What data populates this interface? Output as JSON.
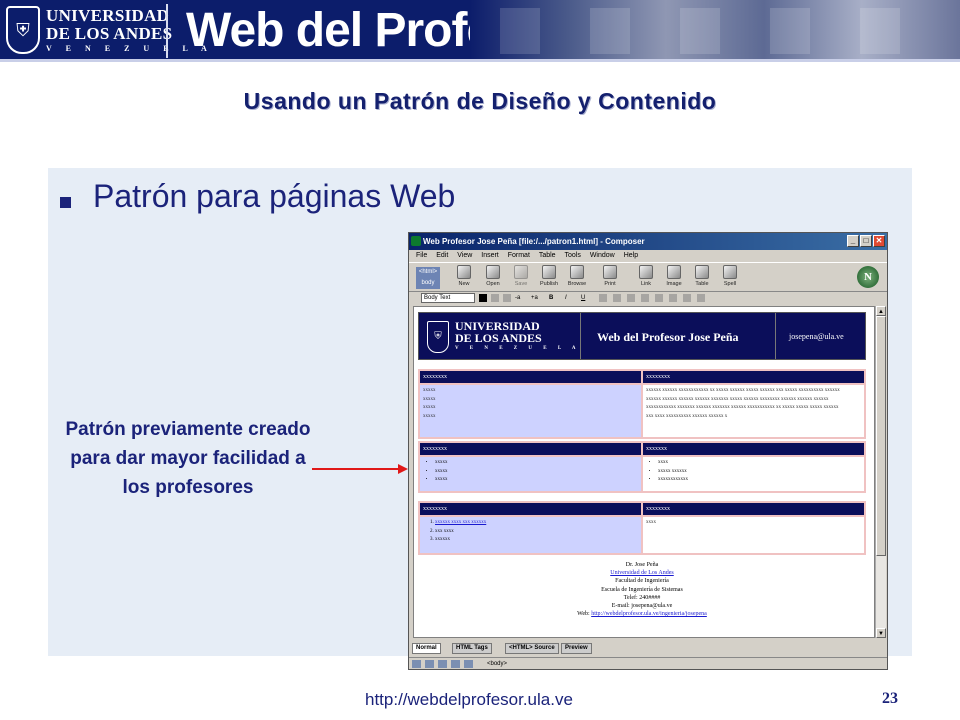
{
  "banner": {
    "university": "UNIVERSIDAD",
    "university2": "DE LOS ANDES",
    "venezuela": "V E N E Z U E L A",
    "site_title": "Web del Profesor"
  },
  "slide": {
    "title": "Usando un Patrón de Diseño y Contenido",
    "bullet": "Patrón para páginas Web",
    "callout": "Patrón previamente creado para dar mayor facilidad a los profesores",
    "footer_url": "http://webdelprofesor.ula.ve",
    "page_number": "23"
  },
  "composer": {
    "window_title": "Web Profesor Jose Peña [file:/.../patron1.html] - Composer",
    "menu": [
      "File",
      "Edit",
      "View",
      "Insert",
      "Format",
      "Table",
      "Tools",
      "Window",
      "Help"
    ],
    "toolbar": [
      "New",
      "Open",
      "Save",
      "Publish",
      "Browse",
      "Print",
      "Link",
      "Image",
      "Table",
      "Spell"
    ],
    "html_tag_label": "<html>",
    "body_label": "body",
    "format_select": "Body Text",
    "format_buttons": [
      "-a",
      "+a",
      "B",
      "I",
      "U"
    ],
    "tabs": [
      "Normal",
      "HTML Tags",
      "<HTML> Source",
      "Preview"
    ],
    "status_tag": "<body>",
    "doc": {
      "header_univ1": "UNIVERSIDAD",
      "header_univ2": "DE LOS ANDES",
      "header_venezuela": "V E N E Z U E L A",
      "header_title": "Web del Profesor Jose Peña",
      "header_email": "josepena@ula.ve",
      "row1": {
        "left_head": "xxxxxxxx",
        "right_head": "xxxxxxxx",
        "left_lines": [
          "xxxxx",
          "xxxxx",
          "xxxxx",
          "xxxxx"
        ],
        "right_lines": [
          "xxxxxx xxxxxx xxxxxxxxxxxx xx xxxxx xxxxxx xxxxx xxxxxx xxx xxxxx xxxxxxxxxx xxxxxx",
          "xxxxxx xxxxxx xxxxxx xxxxxx xxxxxxx xxxxx xxxxxx xxxxxxxx xxxxxx xxxxxx xxxxxx",
          "xxxxxxxxxxxx xxxxxxx xxxxxx xxxxxxx xxxxxx xxxxxxxxxxx xx xxxxx xxxxx xxxxx xxxxxx",
          "xxx xxxx xxxxxxxxxx xxxxxx xxxxxx x"
        ]
      },
      "row2": {
        "left_head": "xxxxxxxx",
        "right_head": "xxxxxxx",
        "left_items": [
          "xxxxx",
          "xxxxx",
          "xxxxx"
        ],
        "right_items": [
          "xxxx",
          "xxxxx xxxxxx",
          "xxxxxxxxxxxx"
        ]
      },
      "row3": {
        "left_head": "xxxxxxxx",
        "right_head": "xxxxxxxx",
        "left_items": [
          "xxxxxx xxxx xxx  xxxxxx",
          "xxx xxxx",
          "xxxxxx"
        ],
        "right_text": "xxxx"
      },
      "footer": {
        "name": "Dr. Jose Peña",
        "university": "Universidad de Los Andes",
        "faculty": "Facultad de Ingeniería",
        "school": "Escuela de Ingeniería de Sistemas",
        "phone": "Telef: 240####",
        "email": "E-mail: josepena@ula.ve",
        "web_label": "Web:",
        "web_link": "http://webdelprofesor.ula.ve/ingenieria/josepena"
      }
    }
  }
}
